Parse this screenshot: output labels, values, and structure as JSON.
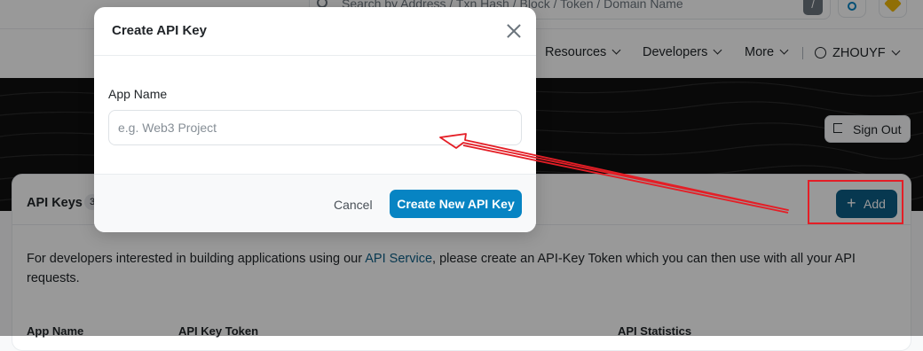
{
  "search": {
    "placeholder": "Search by Address / Txn Hash / Block / Token / Domain Name",
    "shortcut": "/"
  },
  "nav": {
    "items": [
      "Resources",
      "Developers",
      "More"
    ],
    "user": "ZHOUYF"
  },
  "hero": {
    "signout_label": "Sign Out"
  },
  "card": {
    "title": "API Keys",
    "count": "3",
    "add_label": "Add",
    "description_before": "For developers interested in building applications using our ",
    "description_link": "API Service",
    "description_after": ", please create an API-Key Token which you can then use with all your API requests.",
    "columns": [
      "App Name",
      "API Key Token",
      "API Statistics"
    ]
  },
  "modal": {
    "title": "Create API Key",
    "field_label": "App Name",
    "field_placeholder": "e.g. Web3 Project",
    "field_value": "",
    "cancel_label": "Cancel",
    "create_label": "Create New API Key"
  },
  "colors": {
    "accent": "#0784c3",
    "dark_accent": "#0d5e86",
    "annotation": "#e41e26"
  }
}
